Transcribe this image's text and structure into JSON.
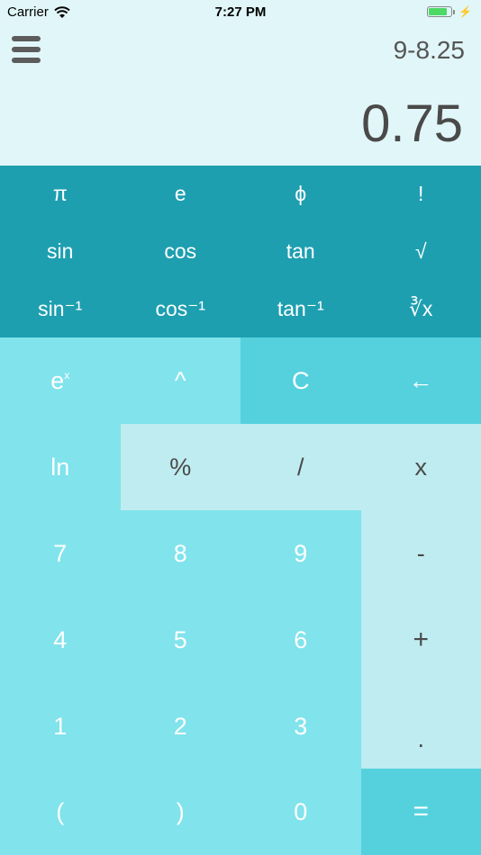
{
  "status_bar": {
    "carrier": "Carrier",
    "time": "7:27 PM",
    "battery_level": 0.85
  },
  "header": {
    "expression": "9-8.25",
    "result": "0.75"
  },
  "scientific_keys": [
    [
      "π",
      "e",
      "ϕ",
      "!"
    ],
    [
      "sin",
      "cos",
      "tan",
      "√"
    ],
    [
      "sin⁻¹",
      "cos⁻¹",
      "tan⁻¹",
      "∛x"
    ]
  ],
  "keypad": {
    "exp": "e",
    "exp_sup": "x",
    "power": "^",
    "clear": "C",
    "backspace": "←",
    "ln": "ln",
    "percent": "%",
    "divide": "/",
    "multiply": "x",
    "seven": "7",
    "eight": "8",
    "nine": "9",
    "minus": "-",
    "four": "4",
    "five": "5",
    "six": "6",
    "plus": "+",
    "one": "1",
    "two": "2",
    "three": "3",
    "dot": ".",
    "lparen": "(",
    "rparen": ")",
    "zero": "0",
    "equals": "="
  },
  "colors": {
    "background": "#e1f6f8",
    "scientific_panel": "#1d9fb0",
    "key_light": "#81e3ec",
    "key_mid": "#55d1de",
    "key_pale": "#bfecf0"
  }
}
